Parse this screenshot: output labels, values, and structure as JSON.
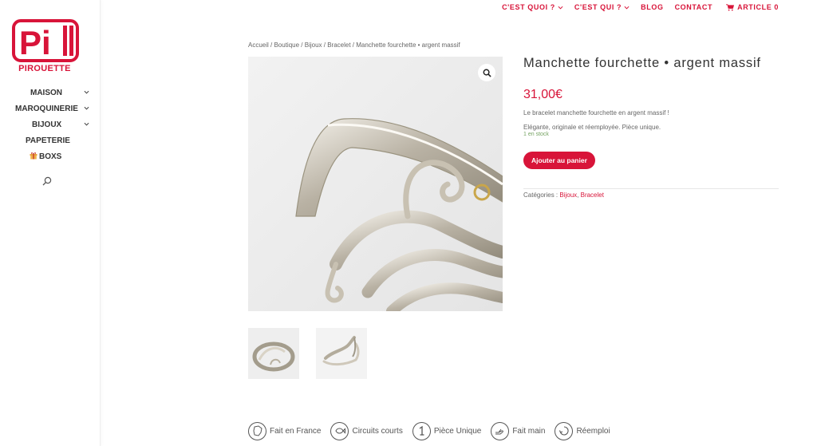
{
  "brand": {
    "logo_text": "PIROUETTE",
    "accent": "#d81439"
  },
  "sidebar": {
    "items": [
      {
        "label": "MAISON",
        "has_submenu": true
      },
      {
        "label": "MAROQUINERIE",
        "has_submenu": true
      },
      {
        "label": "BIJOUX",
        "has_submenu": true
      },
      {
        "label": "PAPETERIE",
        "has_submenu": false
      },
      {
        "label": "BOXS",
        "has_submenu": false,
        "icon": "gift-icon"
      }
    ],
    "search_icon": "search-icon"
  },
  "topnav": {
    "items": [
      {
        "label": "C'EST QUOI ?",
        "has_submenu": true
      },
      {
        "label": "C'EST QUI ?",
        "has_submenu": true
      },
      {
        "label": "BLOG",
        "has_submenu": false
      },
      {
        "label": "CONTACT",
        "has_submenu": false
      }
    ],
    "cart_label": "ARTICLE 0"
  },
  "breadcrumb": {
    "items": [
      "Accueil",
      "Boutique",
      "Bijoux",
      "Bracelet",
      "Manchette fourchette • argent massif"
    ],
    "separator": " / "
  },
  "product": {
    "title": "Manchette fourchette • argent massif",
    "price": "31,00€",
    "desc1": "Le bracelet manchette fourchette en argent massif !",
    "desc2": "Elégante, originale et réemployée. Pièce unique.",
    "stock": "1 en stock",
    "add_to_cart": "Ajouter au panier",
    "categories_label": "Catégories : ",
    "categories": [
      "Bijoux",
      "Bracelet"
    ],
    "category_sep": ", "
  },
  "features": [
    {
      "label": "Fait en France",
      "icon": "france-map-icon"
    },
    {
      "label": "Circuits courts",
      "icon": "fish-icon"
    },
    {
      "label": "Pièce Unique",
      "icon": "number-one-icon"
    },
    {
      "label": "Fait main",
      "icon": "hand-icon"
    },
    {
      "label": "Réemploi",
      "icon": "recycle-icon"
    }
  ]
}
